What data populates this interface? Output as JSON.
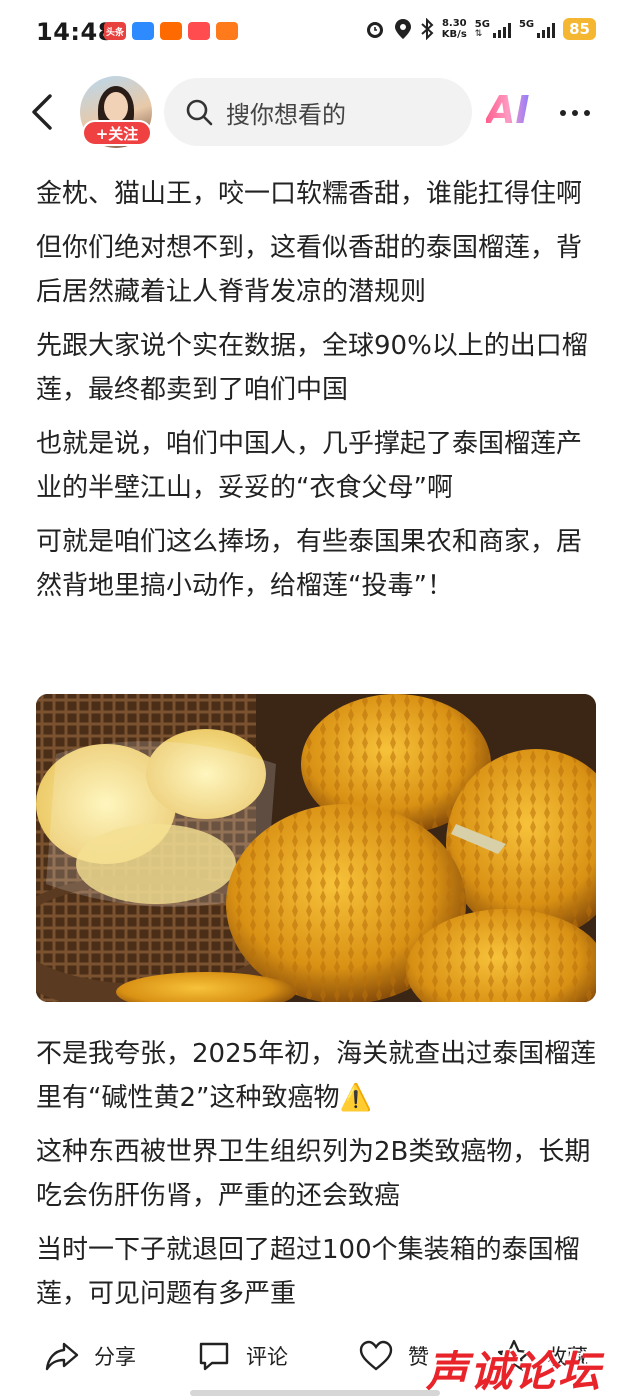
{
  "status_bar": {
    "time": "14:48",
    "net_speed_value": "8.30",
    "net_speed_unit": "KB/s",
    "signal1_label": "5G",
    "signal2_label": "5G",
    "battery": "85",
    "app_icons": [
      {
        "label": "头条",
        "color": "#e8423f"
      },
      {
        "label": "",
        "color": "#2e8bff"
      },
      {
        "label": "",
        "color": "#ff6a00"
      },
      {
        "label": "",
        "color": "#ff4d4f"
      },
      {
        "label": "",
        "color": "#ff7a1a"
      }
    ]
  },
  "nav": {
    "follow_label": "+关注",
    "search_placeholder": "搜你想看的",
    "ai_label": "AI"
  },
  "article": {
    "paragraphs_top": [
      "金枕、猫山王，咬一口软糯香甜，谁能扛得住啊",
      "但你们绝对想不到，这看似香甜的泰国榴莲，背后居然藏着让人脊背发凉的潜规则",
      "先跟大家说个实在数据，全球90%以上的出口榴莲，最终都卖到了咱们中国",
      "也就是说，咱们中国人，几乎撑起了泰国榴莲产业的半壁江山，妥妥的“衣食父母”啊",
      "可就是咱们这么捧场，有些泰国果农和商家，居然背地里搞小动作，给榴莲“投毒”！"
    ],
    "paragraphs_bottom": [
      "不是我夸张，2025年初，海关就查出过泰国榴莲里有“碱性黄2”这种致癌物⚠️",
      "这种东西被世界卫生组织列为2B类致癌物，长期吃会伤肝伤肾，严重的还会致癌",
      "当时一下子就退回了超过100个集装箱的泰国榴莲，可见问题有多严重"
    ]
  },
  "bottom_bar": {
    "share_label": "分享",
    "comment_label": "评论",
    "like_label": "赞",
    "favorite_label": "收藏"
  },
  "watermark": "声诚论坛",
  "colors": {
    "accent": "#f04142",
    "battery": "#f5b731",
    "watermark": "#e8232a"
  }
}
